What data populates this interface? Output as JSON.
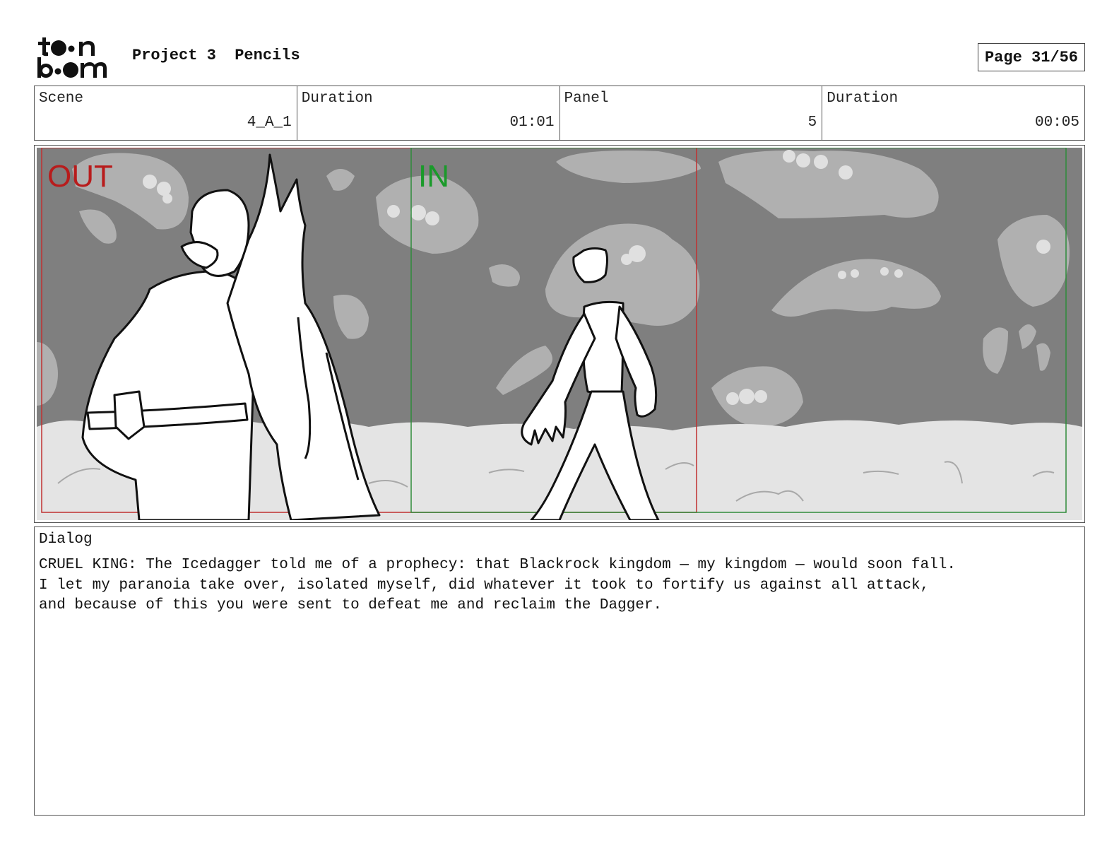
{
  "header": {
    "logo_text": "toon boom",
    "project": "Project 3",
    "stage": "Pencils",
    "page": "Page 31/56"
  },
  "info": {
    "scene_label": "Scene",
    "scene_value": "4_A_1",
    "duration_label": "Duration",
    "duration_value": "01:01",
    "panel_label": "Panel",
    "panel_value": "5",
    "panel_duration_label": "Duration",
    "panel_duration_value": "00:05"
  },
  "panel": {
    "out_label": "OUT",
    "in_label": "IN",
    "out_color": "#b81c1c",
    "in_color": "#1a9a2a"
  },
  "dialog": {
    "label": "Dialog",
    "lines": [
      "CRUEL KING: The Icedagger told me of a prophecy: that Blackrock kingdom — my kingdom — would soon fall.",
      "I let my paranoia take over, isolated myself, did whatever it took to fortify us against all attack,",
      "and because of this you were sent to defeat me and reclaim the Dagger."
    ]
  }
}
